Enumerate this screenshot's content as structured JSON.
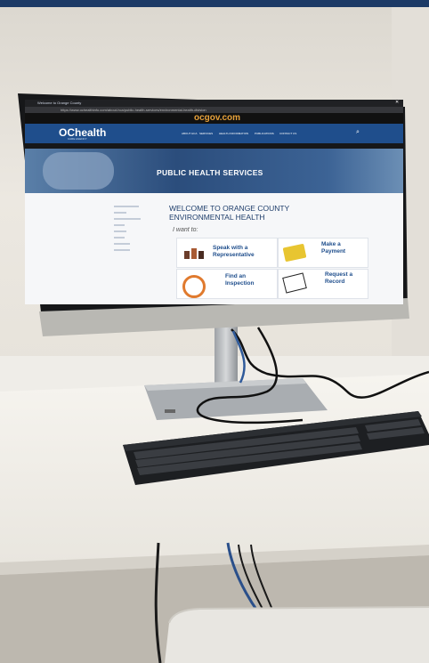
{
  "browser": {
    "tab_title": "Welcome to Orange County",
    "url": "https://www.ochealthinfo.com/about-hca/public-health-services/environmental-health-division"
  },
  "top_banner": {
    "site_name": "ocgov.com"
  },
  "site_header": {
    "logo_text": "OChealth",
    "logo_subtext": "CARE AGENCY",
    "nav": [
      "ABOUT HCA",
      "SERVICES",
      "HEALTH INFORMATION",
      "PUBLICATIONS",
      "CONTACT US"
    ]
  },
  "hero": {
    "title": "PUBLIC HEALTH SERVICES"
  },
  "page": {
    "welcome_title_line1": "WELCOME TO ORANGE COUNTY",
    "welcome_title_line2": "ENVIRONMENTAL HEALTH",
    "i_want_to": "I want to:",
    "options": [
      {
        "line1": "Speak with a",
        "line2": "Representative"
      },
      {
        "line1": "Make a",
        "line2": "Payment"
      },
      {
        "line1": "Find an",
        "line2": "Inspection"
      },
      {
        "line1": "Request a",
        "line2": "Record"
      }
    ]
  },
  "colors": {
    "header_blue": "#1f4e8c",
    "site_black": "#111111",
    "accent_yellow": "#e8c531",
    "accent_orange": "#e07a2e"
  },
  "icons": [
    "chrome-close-icon",
    "search-icon",
    "facebook-icon",
    "twitter-icon",
    "instagram-icon"
  ]
}
